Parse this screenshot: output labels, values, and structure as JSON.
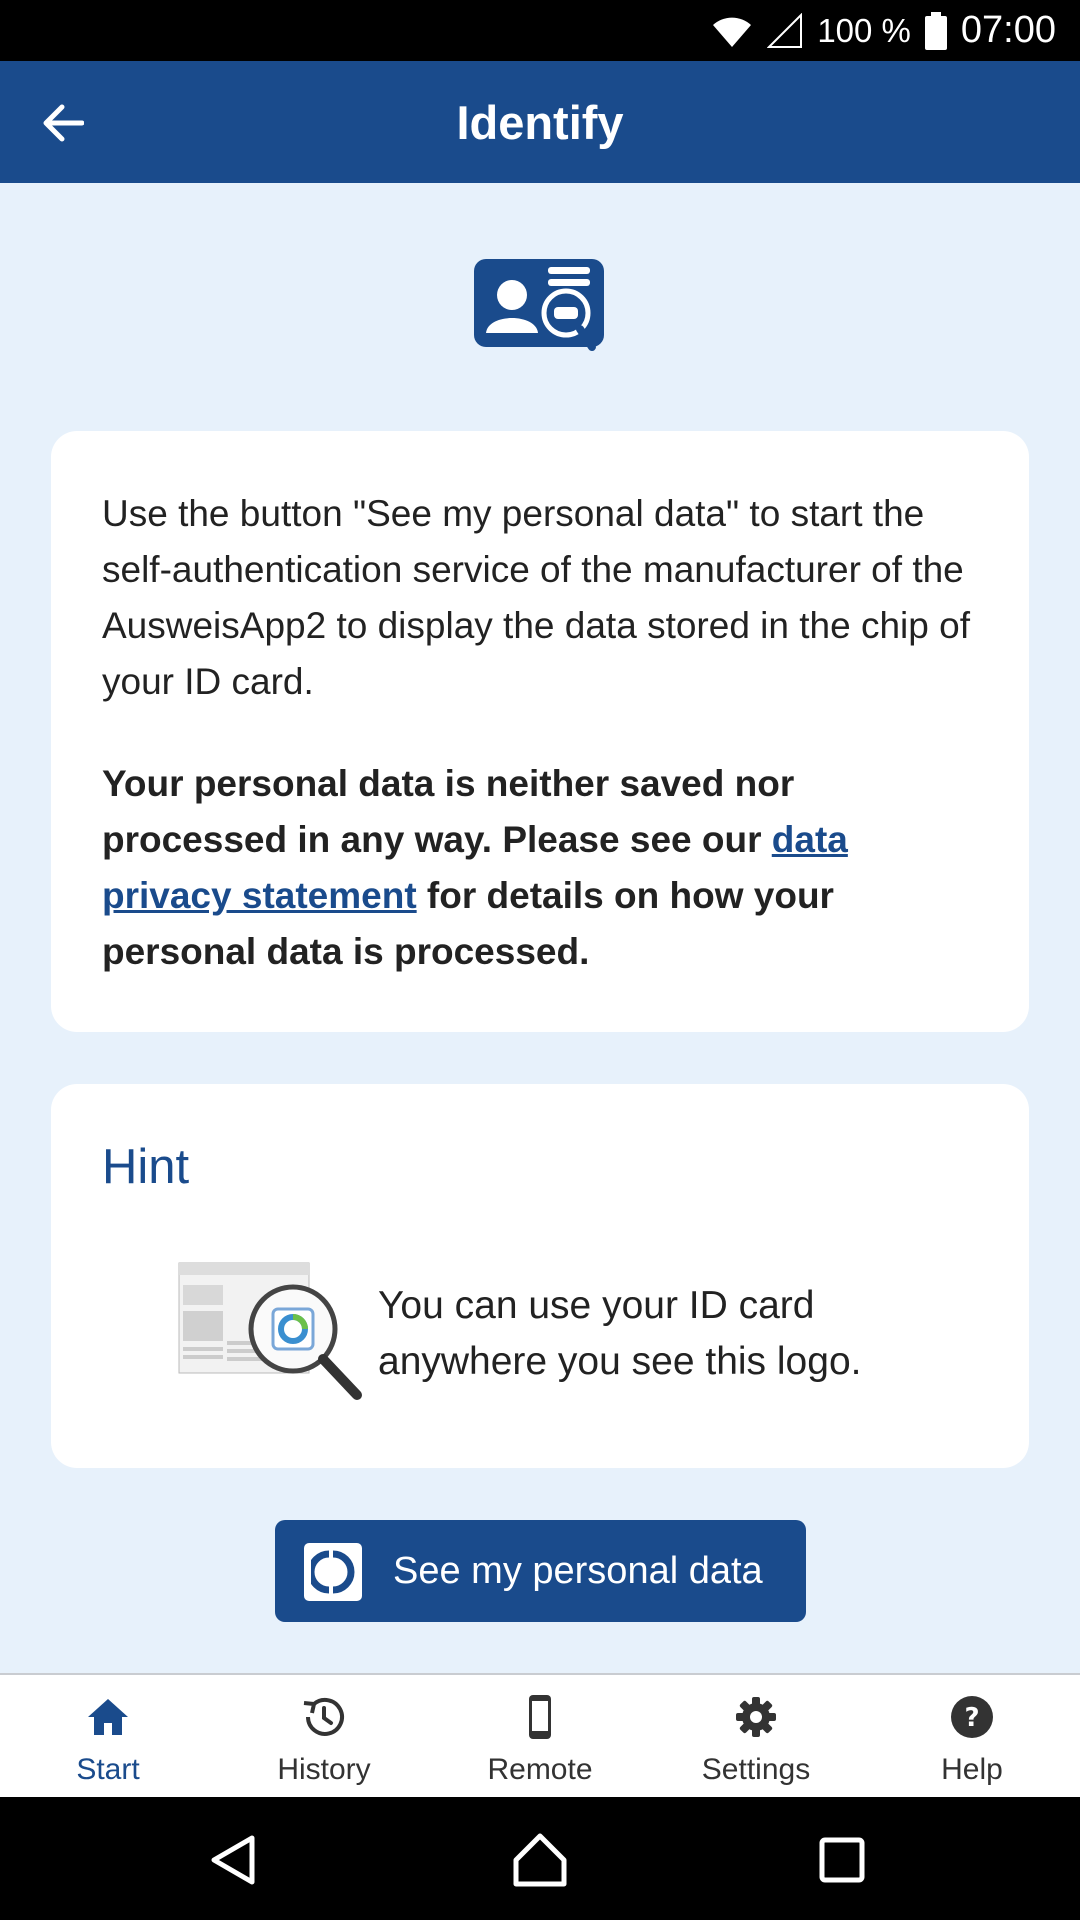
{
  "status_bar": {
    "battery_percent": "100 %",
    "time": "07:00",
    "icons": [
      "wifi-icon",
      "signal-icon",
      "battery-icon"
    ]
  },
  "app_bar": {
    "title": "Identify",
    "back_icon": "arrow-back-icon"
  },
  "hero": {
    "icon": "id-card-search-icon"
  },
  "info_card": {
    "intro": "Use the button \"See my personal data\" to start the self-authentication service of the manufacturer of the AusweisApp2 to display the data stored in the chip of your ID card.",
    "privacy_part1": "Your personal data is neither saved nor processed in any way. Please see our ",
    "privacy_link": "data privacy statement",
    "privacy_part2": " for details on how your personal data is processed."
  },
  "hint_card": {
    "title": "Hint",
    "text": "You can use your ID card anywhere you see this logo.",
    "image": "website-magnifier-logo-illustration"
  },
  "cta_button": {
    "label": "See my personal data",
    "icon": "eid-logo-icon"
  },
  "bottom_nav": {
    "items": [
      {
        "label": "Start",
        "icon": "home-icon",
        "active": true
      },
      {
        "label": "History",
        "icon": "history-icon",
        "active": false
      },
      {
        "label": "Remote",
        "icon": "phone-icon",
        "active": false
      },
      {
        "label": "Settings",
        "icon": "gear-icon",
        "active": false
      },
      {
        "label": "Help",
        "icon": "help-icon",
        "active": false
      }
    ]
  },
  "system_nav": {
    "icons": [
      "back-triangle-icon",
      "home-circle-icon",
      "recents-square-icon"
    ]
  },
  "colors": {
    "primary": "#1a4b8c",
    "background": "#e7f1fb",
    "card": "#ffffff"
  }
}
